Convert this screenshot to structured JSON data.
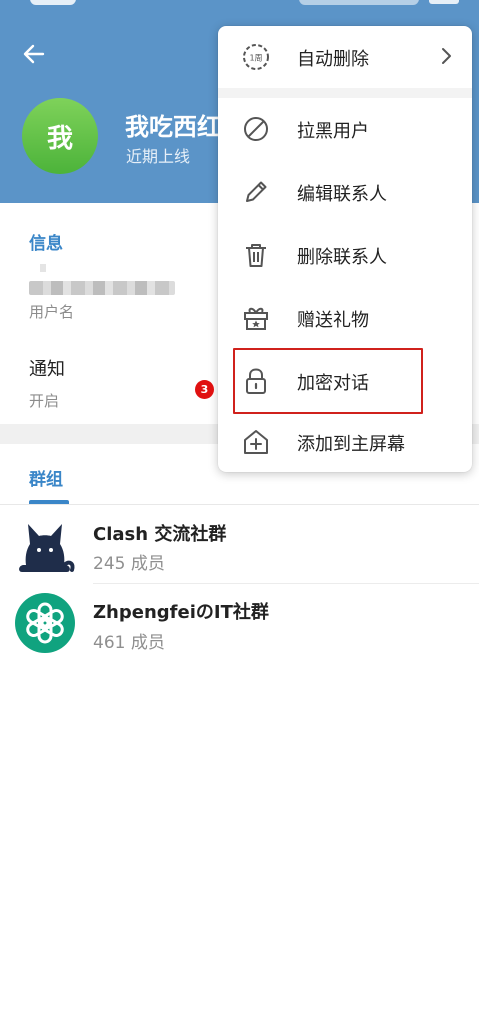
{
  "profile": {
    "avatar_char": "我",
    "name": "我吃西红柿",
    "status": "近期上线"
  },
  "info": {
    "section_title": "信息",
    "username_label": "用户名",
    "notify_label": "通知",
    "notify_value": "开启"
  },
  "groups": {
    "tab_label": "群组",
    "items": [
      {
        "name": "Clash 交流社群",
        "members": "245 成员",
        "icon": "cat-icon"
      },
      {
        "name": "ZhpengfeiのIT社群",
        "members": "461 成员",
        "icon": "openai-icon"
      }
    ]
  },
  "menu": {
    "auto_delete_badge": "1周",
    "items": [
      {
        "label": "自动删除",
        "icon": "timer-icon"
      },
      {
        "label": "拉黑用户",
        "icon": "block-icon"
      },
      {
        "label": "编辑联系人",
        "icon": "pencil-icon"
      },
      {
        "label": "删除联系人",
        "icon": "trash-icon"
      },
      {
        "label": "赠送礼物",
        "icon": "gift-icon"
      },
      {
        "label": "加密对话",
        "icon": "lock-icon"
      },
      {
        "label": "添加到主屏幕",
        "icon": "home-add-icon"
      }
    ]
  },
  "annotation": {
    "step": "3"
  },
  "colors": {
    "header": "#5b94c8",
    "accent": "#3a86c8",
    "highlight": "#d0211c",
    "avatar": "#5cbf45"
  }
}
